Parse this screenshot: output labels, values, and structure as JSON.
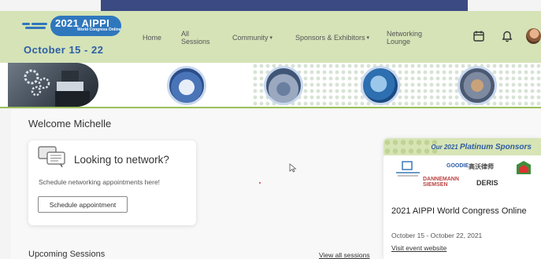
{
  "header": {
    "logo_year": "2021 AIPPI",
    "logo_sub": "World Congress Online",
    "dates": "October 15 - 22",
    "nav": [
      {
        "id": "home",
        "label": "Home",
        "has_dropdown": false
      },
      {
        "id": "all-sessions",
        "label": "All\nSessions",
        "has_dropdown": false
      },
      {
        "id": "community",
        "label": "Community",
        "has_dropdown": true
      },
      {
        "id": "sponsors",
        "label": "Sponsors & Exhibitors",
        "has_dropdown": true
      },
      {
        "id": "networking",
        "label": "Networking\nLounge",
        "has_dropdown": false
      }
    ],
    "icons": [
      "calendar-icon",
      "bell-icon"
    ]
  },
  "main": {
    "welcome": "Welcome Michelle",
    "network_card": {
      "title": "Looking to network?",
      "description": "Schedule networking appointments here!",
      "button": "Schedule appointment"
    },
    "upcoming": "Upcoming Sessions",
    "view_all": "View all sessions"
  },
  "event_card": {
    "sponsor_heading_prefix": "Our 2021 ",
    "sponsor_heading_emph": "Platinum Sponsors",
    "sponsors": [
      "GOODIE",
      "高沃律师",
      "DANNEMANN SIEMSEN",
      "DERIS"
    ],
    "title": "2021 AIPPI World Congress Online",
    "dates": "October 15 - October 22, 2021",
    "link": "Visit event website"
  },
  "colors": {
    "header_bg": "#d5e3b7",
    "brand_blue": "#2f77bd",
    "accent_green": "#9ac05b"
  }
}
